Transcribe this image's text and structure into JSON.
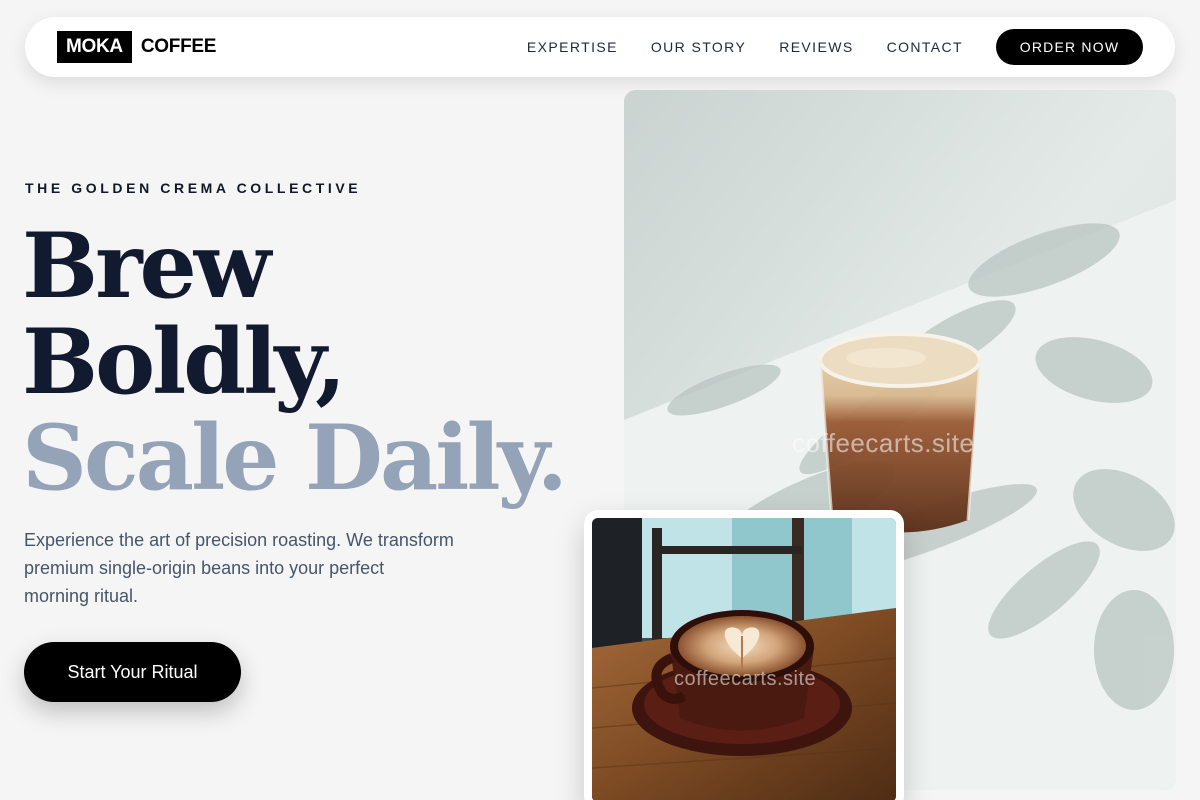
{
  "nav": {
    "logo_box": "MOKA",
    "logo_text": "COFFEE",
    "links": [
      "EXPERTISE",
      "OUR STORY",
      "REVIEWS",
      "CONTACT"
    ],
    "order_label": "ORDER NOW"
  },
  "hero": {
    "eyebrow": "THE GOLDEN CREMA COLLECTIVE",
    "headline_line1": "Brew",
    "headline_line2": "Boldly,",
    "headline_line3": "Scale Daily.",
    "lead": "Experience the art of precision roasting. We transform premium single-origin beans into your perfect morning ritual.",
    "cta_label": "Start Your Ritual"
  },
  "images": {
    "main_watermark": "coffeecarts.site",
    "inset_watermark": "coffeecarts.site"
  },
  "colors": {
    "accent": "#000000",
    "headline": "#111a2e",
    "headline_muted": "#94a3b8",
    "background": "#f5f5f5"
  }
}
